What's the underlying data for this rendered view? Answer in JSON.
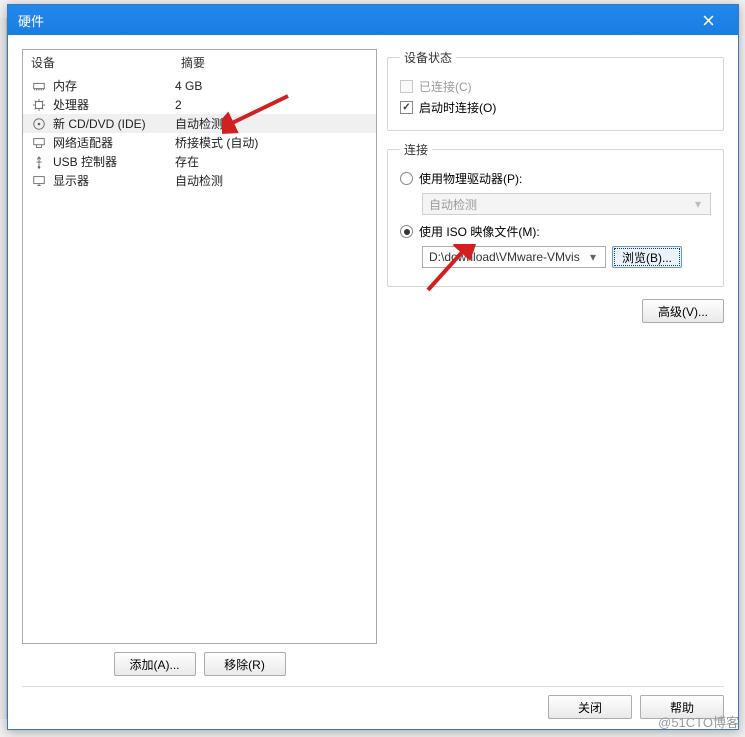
{
  "window": {
    "title": "硬件"
  },
  "deviceList": {
    "header_device": "设备",
    "header_summary": "摘要",
    "items": [
      {
        "icon": "memory-icon",
        "name": "内存",
        "summary": "4 GB",
        "selected": false
      },
      {
        "icon": "cpu-icon",
        "name": "处理器",
        "summary": "2",
        "selected": false
      },
      {
        "icon": "disc-icon",
        "name": "新 CD/DVD (IDE)",
        "summary": "自动检测",
        "selected": true
      },
      {
        "icon": "network-icon",
        "name": "网络适配器",
        "summary": "桥接模式 (自动)",
        "selected": false
      },
      {
        "icon": "usb-icon",
        "name": "USB 控制器",
        "summary": "存在",
        "selected": false
      },
      {
        "icon": "display-icon",
        "name": "显示器",
        "summary": "自动检测",
        "selected": false
      }
    ],
    "add_label": "添加(A)...",
    "remove_label": "移除(R)"
  },
  "status": {
    "legend": "设备状态",
    "connected_label": "已连接(C)",
    "connected_checked": false,
    "connected_enabled": false,
    "connect_at_power_on_label": "启动时连接(O)",
    "connect_at_power_on_checked": true
  },
  "connection": {
    "legend": "连接",
    "use_physical_label": "使用物理驱动器(P):",
    "physical_selected": "自动检测",
    "use_physical_checked": false,
    "use_iso_label": "使用 ISO 映像文件(M):",
    "use_iso_checked": true,
    "iso_path": "D:\\download\\VMware-VMvis",
    "browse_label": "浏览(B)..."
  },
  "advanced_label": "高级(V)...",
  "footer": {
    "close_label": "关闭",
    "help_label": "帮助"
  },
  "watermark": "@51CTO博客"
}
